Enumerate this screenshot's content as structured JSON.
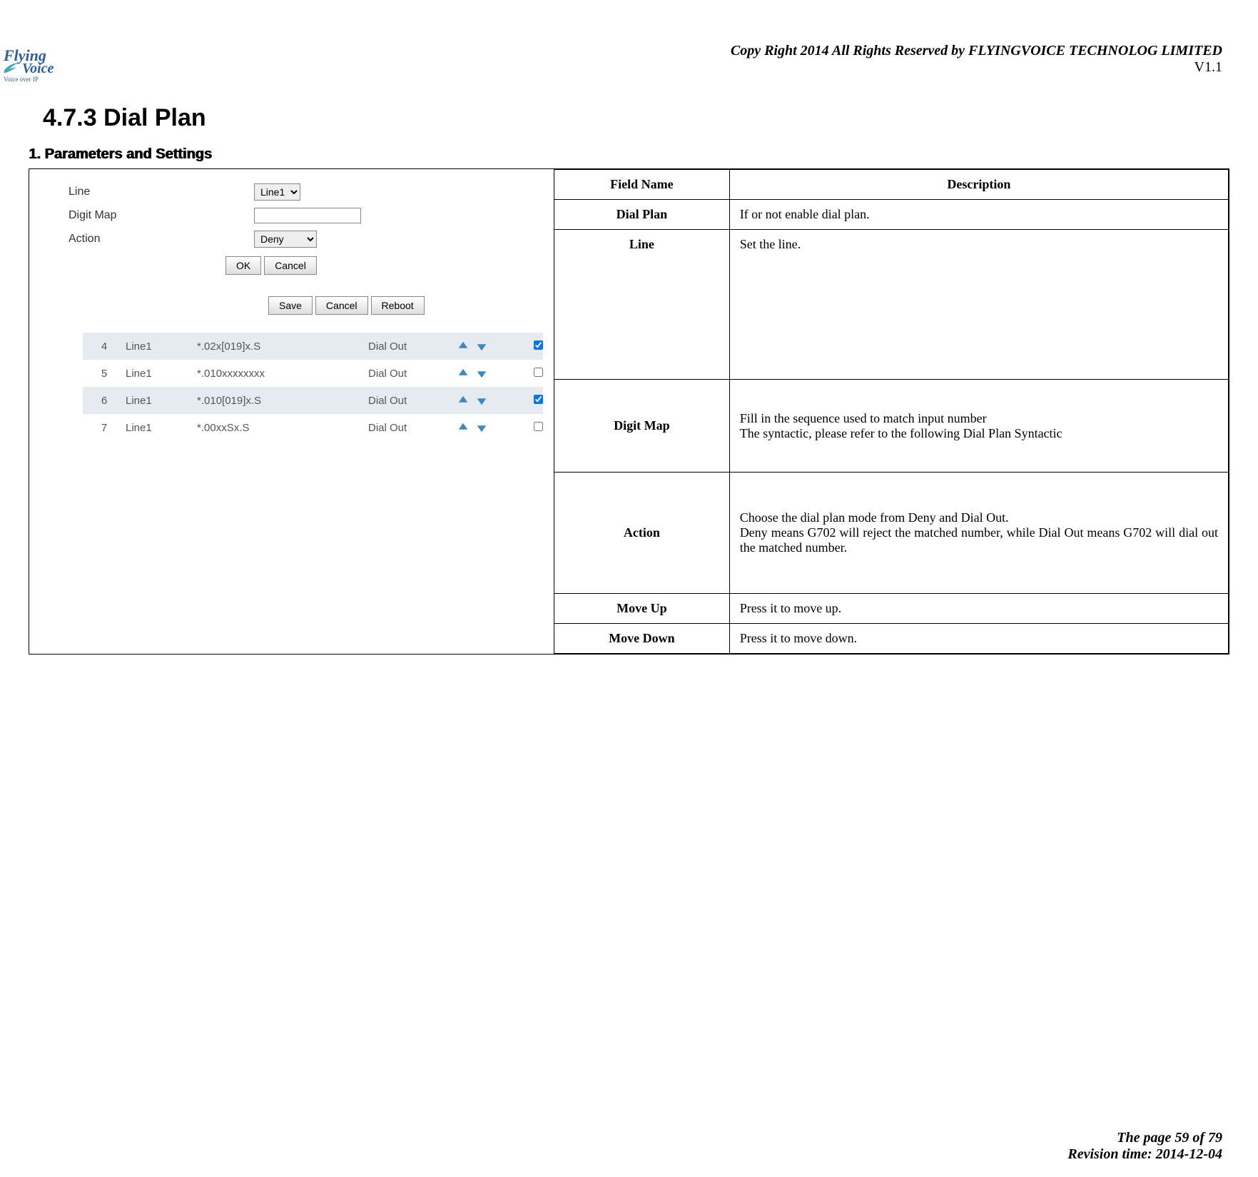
{
  "header": {
    "logo_main": "Flying",
    "logo_sub1": "Voice",
    "logo_tagline": "Voice over IP",
    "copyright": "Copy Right 2014 All Rights Reserved by FLYINGVOICE TECHNOLOG LIMITED",
    "version": "V1.1"
  },
  "section": {
    "number_title": "4.7.3 Dial Plan",
    "sub1": "1.  Parameters and Settings"
  },
  "form": {
    "line_label": "Line",
    "line_value": "Line1",
    "digitmap_label": "Digit Map",
    "digitmap_value": "",
    "action_label": "Action",
    "action_value": "Deny",
    "btn_ok": "OK",
    "btn_cancel": "Cancel",
    "btn_save": "Save",
    "btn_cancel2": "Cancel",
    "btn_reboot": "Reboot"
  },
  "rules": [
    {
      "num": "4",
      "line": "Line1",
      "pattern": "*.02x[019]x.S",
      "action": "Dial Out",
      "checked": true,
      "alt": true
    },
    {
      "num": "5",
      "line": "Line1",
      "pattern": "*.010xxxxxxxx",
      "action": "Dial Out",
      "checked": false,
      "alt": false
    },
    {
      "num": "6",
      "line": "Line1",
      "pattern": "*.010[019]x.S",
      "action": "Dial Out",
      "checked": true,
      "alt": true
    },
    {
      "num": "7",
      "line": "Line1",
      "pattern": "*.00xxSx.S",
      "action": "Dial Out",
      "checked": false,
      "alt": false
    }
  ],
  "desc_table": {
    "header_field": "Field Name",
    "header_desc": "Description",
    "rows": [
      {
        "field": "Dial Plan",
        "desc": "If or not enable dial plan."
      },
      {
        "field": "Line",
        "desc": "Set the line."
      },
      {
        "field": "Digit Map",
        "desc": "Fill in the sequence used to match input number\nThe syntactic, please refer to the following Dial Plan Syntactic"
      },
      {
        "field": "Action",
        "desc": "Choose the dial plan mode from Deny and Dial Out.\nDeny means G702 will reject the matched number, while Dial Out means G702 will dial out the matched number."
      },
      {
        "field": "Move Up",
        "desc": "Press it to move up."
      },
      {
        "field": "Move Down",
        "desc": "Press it to move down."
      }
    ]
  },
  "footer": {
    "page": "The page 59 of 79",
    "revision": "Revision time: 2014-12-04"
  }
}
